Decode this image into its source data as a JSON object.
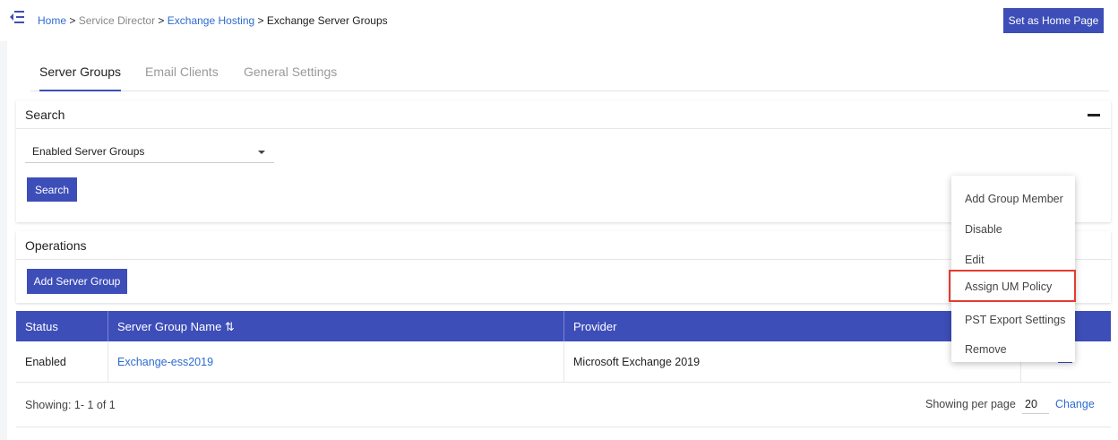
{
  "breadcrumb": {
    "home": "Home",
    "sep1": ">",
    "service_director": "Service Director",
    "sep2": ">",
    "exchange_hosting": "Exchange Hosting",
    "sep3": ">",
    "current": "Exchange Server Groups"
  },
  "header": {
    "set_home_label": "Set as Home Page"
  },
  "tabs": [
    {
      "label": "Server Groups",
      "active": true
    },
    {
      "label": "Email Clients",
      "active": false
    },
    {
      "label": "General Settings",
      "active": false
    }
  ],
  "search": {
    "title": "Search",
    "filter_value": "Enabled Server Groups",
    "button_label": "Search"
  },
  "operations": {
    "title": "Operations",
    "add_button_label": "Add Server Group"
  },
  "table": {
    "columns": [
      "Status",
      "Server Group Name ⇅",
      "Provider"
    ],
    "rows": [
      {
        "status": "Enabled",
        "name": "Exchange-ess2019",
        "provider": "Microsoft Exchange 2019"
      }
    ]
  },
  "pagination": {
    "showing": "Showing: 1- 1 of 1",
    "per_page_label": "Showing per page",
    "per_page_value": "20",
    "change_label": "Change"
  },
  "context_menu": {
    "items": [
      "Add Group Member",
      "Disable",
      "Edit",
      "Assign UM Policy",
      "PST Export Settings",
      "Remove"
    ],
    "highlighted": "Assign UM Policy"
  },
  "colors": {
    "primary": "#3d4eb8",
    "link": "#2d6bd1",
    "highlight_border": "#e53b2f"
  }
}
